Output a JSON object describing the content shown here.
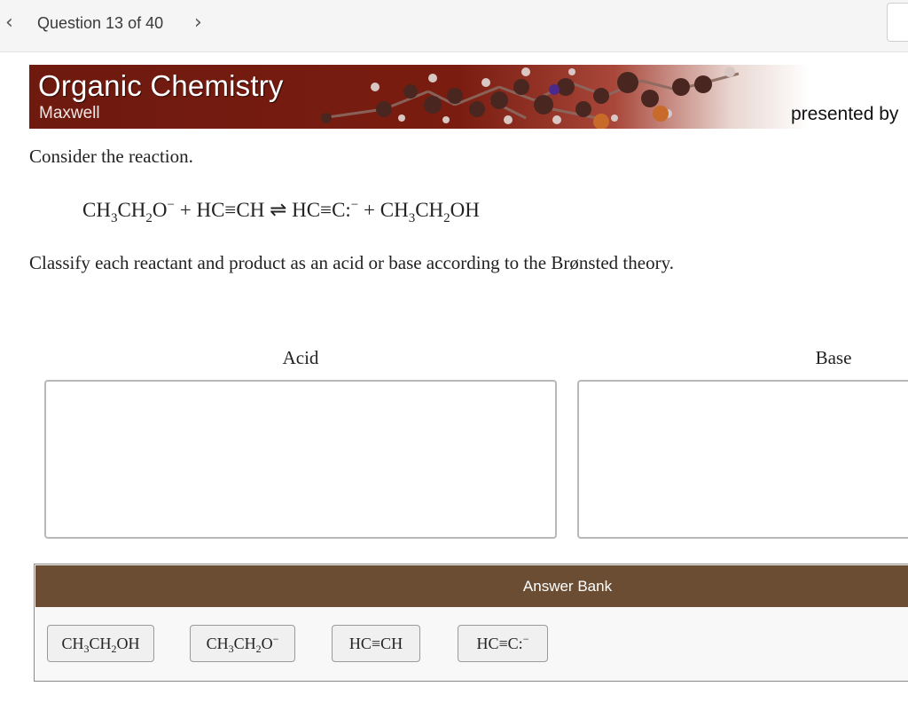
{
  "nav": {
    "prev_icon": "chevron-left",
    "next_icon": "chevron-right",
    "question_label": "Question 13 of 40"
  },
  "banner": {
    "title": "Organic Chemistry",
    "author": "Maxwell",
    "presented_by": "presented by",
    "colors": {
      "background": "#6e1a0f",
      "atom": "#5a2a22"
    }
  },
  "question": {
    "intro": "Consider the reaction.",
    "equation": {
      "r1_a": "CH",
      "r1_a_sub": "3",
      "r1_b": "CH",
      "r1_b_sub": "2",
      "r1_c": "O",
      "r1_c_sup": "−",
      "plus1": "+",
      "r2": "HC≡CH",
      "arrow": "⇌",
      "p1": "HC≡C:",
      "p1_sup": "−",
      "plus2": "+",
      "p2_a": "CH",
      "p2_a_sub": "3",
      "p2_b": "CH",
      "p2_b_sub": "2",
      "p2_c": "OH"
    },
    "instruction": "Classify each reactant and product as an acid or base according to the Brønsted theory."
  },
  "bins": {
    "acid_label": "Acid",
    "base_label": "Base"
  },
  "answer_bank": {
    "title": "Answer Bank",
    "header_color": "#6a4d33",
    "items": [
      {
        "a": "CH",
        "a_sub": "3",
        "b": "CH",
        "b_sub": "2",
        "c": "OH",
        "c_sup": ""
      },
      {
        "a": "CH",
        "a_sub": "3",
        "b": "CH",
        "b_sub": "2",
        "c": "O",
        "c_sup": "−"
      },
      {
        "text": "HC≡CH"
      },
      {
        "text": "HC≡C:",
        "sup": "−"
      }
    ]
  }
}
